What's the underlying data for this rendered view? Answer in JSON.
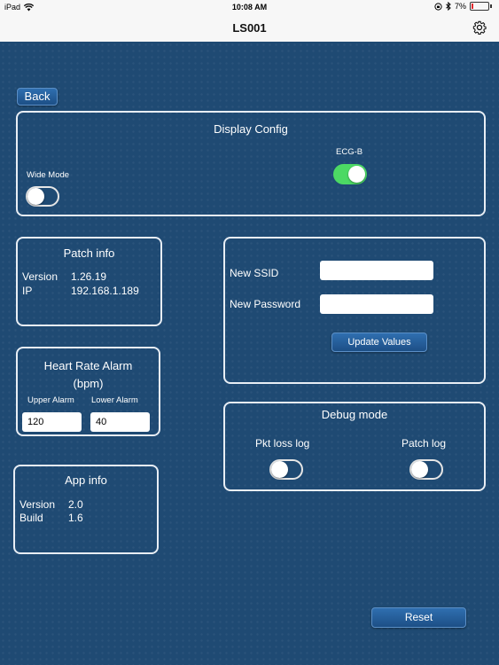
{
  "status_bar": {
    "carrier": "iPad",
    "time": "10:08 AM",
    "battery": "7%"
  },
  "nav": {
    "title": "LS001",
    "settings_icon": "gear-icon"
  },
  "back_button": "Back",
  "display_config": {
    "title": "Display Config",
    "wide_mode": {
      "label": "Wide Mode",
      "on": false
    },
    "ecg_b": {
      "label": "ECG-B",
      "on": true
    }
  },
  "patch_info": {
    "title": "Patch info",
    "version_label": "Version",
    "version": "1.26.19",
    "ip_label": "IP",
    "ip": "192.168.1.189"
  },
  "wifi": {
    "ssid_label": "New SSID",
    "ssid_value": "",
    "password_label": "New Password",
    "password_value": "",
    "update_button": "Update Values"
  },
  "heart_rate_alarm": {
    "title": "Heart Rate Alarm",
    "unit": "(bpm)",
    "upper_label": "Upper Alarm",
    "upper_value": "120",
    "lower_label": "Lower Alarm",
    "lower_value": "40"
  },
  "debug_mode": {
    "title": "Debug mode",
    "pkt_loss_label": "Pkt loss log",
    "pkt_loss_on": false,
    "patch_log_label": "Patch log",
    "patch_log_on": false
  },
  "app_info": {
    "title": "App info",
    "version_label": "Version",
    "version": "2.0",
    "build_label": "Build",
    "build": "1.6"
  },
  "reset_button": "Reset",
  "colors": {
    "background": "#1f4a73",
    "toggle_on": "#4cd964",
    "button": "#2a64a3"
  }
}
